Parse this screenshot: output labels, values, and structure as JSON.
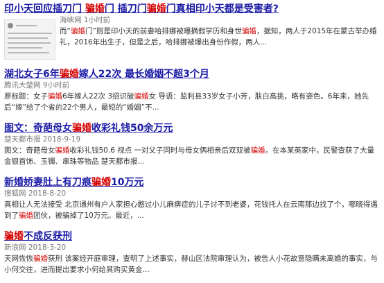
{
  "results": [
    {
      "title_parts": [
        {
          "t": "印小天回应插刀门 ",
          "hl": false
        },
        {
          "t": "骗婚",
          "hl": true
        },
        {
          "t": "门 插刀门",
          "hl": false
        },
        {
          "t": "骗婚",
          "hl": true
        },
        {
          "t": "门真相印小天都是受害者?",
          "hl": false
        }
      ],
      "source": "海峡网",
      "time": "1小时前",
      "snippet_parts": [
        {
          "t": "而“",
          "em": false
        },
        {
          "t": "骗婚",
          "em": true
        },
        {
          "t": "门”则是印小天的前妻哈排娜被曝摘假学历和身世",
          "em": false
        },
        {
          "t": "骗婚",
          "em": true
        },
        {
          "t": "，据知，两人于2015年在蒙古举办婚礼，2016年出生子，但是之后，哈排娜被爆出身份作假，两人...",
          "em": false
        }
      ]
    },
    {
      "title_parts": [
        {
          "t": "湖北女子6年",
          "hl": false
        },
        {
          "t": "骗婚",
          "hl": true
        },
        {
          "t": "嫁人22次 最长婚姻不超3个月",
          "hl": false
        }
      ],
      "source": "腾讯大楚网",
      "time": "9小时前",
      "snippet_parts": [
        {
          "t": "原标题：女子",
          "em": false
        },
        {
          "t": "骗婚",
          "em": true
        },
        {
          "t": "6年嫁人22次 3招识破",
          "em": false
        },
        {
          "t": "骗婚",
          "em": true
        },
        {
          "t": "女 导语：监利县33岁女子小芳，肤白高挑，略有姿色。6年来，她先后“嫁”给了个省的22个男人，最短的“婚姻”不...",
          "em": false
        }
      ]
    },
    {
      "title_parts": [
        {
          "t": "图文：奇葩母女",
          "hl": false
        },
        {
          "t": "骗婚",
          "hl": true
        },
        {
          "t": "收彩礼钱50余万元",
          "hl": false
        }
      ],
      "source": "楚天都市报",
      "time": "2018-9-19",
      "snippet_parts": [
        {
          "t": "图文：奇葩母女",
          "em": false
        },
        {
          "t": "骗婚",
          "em": true
        },
        {
          "t": "收彩礼钱50.6 视点 一对父子同时与母女俩相亲后双双被",
          "em": false
        },
        {
          "t": "骗婚",
          "em": true
        },
        {
          "t": "。在本某英家中，民警查获了大量金银首饰、玉镯、串珠等物品 楚天都市报...",
          "em": false
        }
      ]
    },
    {
      "title_parts": [
        {
          "t": "新婚娇妻肚上有刀痕",
          "hl": false
        },
        {
          "t": "骗婚",
          "hl": true
        },
        {
          "t": "10万元",
          "hl": false
        }
      ],
      "source": "搜狐网",
      "time": "2018-8-20",
      "snippet_parts": [
        {
          "t": "真相让人无法接受 北京通州有户人家担心憨过小儿麻痹症的儿子讨不到老婆，花钱托人在云南那边找了个，哪晓得遇到了",
          "em": false
        },
        {
          "t": "骗婚",
          "em": true
        },
        {
          "t": "团伙，被骗掉了10万元。最近，...",
          "em": false
        }
      ]
    },
    {
      "title_parts": [
        {
          "t": "骗婚",
          "hl": true
        },
        {
          "t": "不成反获刑",
          "hl": false
        }
      ],
      "source": "新浪网",
      "time": "2018-3-20",
      "snippet_parts": [
        {
          "t": "天网恢恢",
          "em": false
        },
        {
          "t": "骗婚",
          "em": true
        },
        {
          "t": "获刑 该案经开庭审理，查明了上述事实，赫山区法院审理认为，被告人小花故意隐瞒未离婚的事实，与小何交往，进而提出要求小何给其购买黄金...",
          "em": false
        }
      ]
    }
  ]
}
